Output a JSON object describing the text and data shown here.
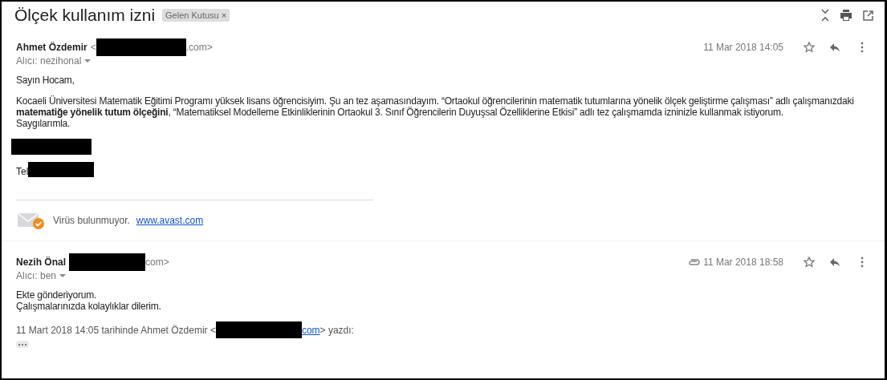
{
  "subject": "Ölçek kullanım izni",
  "label": {
    "text": "Gelen Kutusu",
    "close": "×"
  },
  "messages": [
    {
      "sender": "Ahmet Özdemir",
      "address_prefix": "<",
      "address_suffix": ".com>",
      "recipient": "Alıcı: nezihonal",
      "has_attachment": false,
      "date": "11 Mar 2018 14:05",
      "starred": false,
      "blocks": [
        {
          "kind": "text",
          "lines": [
            "Sayın Hocam,"
          ]
        },
        {
          "kind": "text",
          "lines": [
            "Kocaeli Üniversitesi Matematik Eğitimi Programı yüksek lisans öğrencisiyim. Şu an tez aşamasındayım. “Ortaokul öğrencilerinin matematik tutumlarına yönelik ölçek geliştirme çalışması” adlı çalışmanızdaki **matematiğe yönelik tutum ölçeğini**, “Matematiksel Modelleme Etkinliklerinin Ortaokul 3. Sınıf Öğrencilerin Duyuşsal Özelliklerine Etkisi” adlı tez çalışmamda izninizle kullanmak istiyorum.",
            "Saygılarımla."
          ]
        },
        {
          "kind": "redaction"
        },
        {
          "kind": "tel",
          "label": "Tel"
        },
        {
          "kind": "avast",
          "text": "Virüs bulunmuyor.",
          "link": "www.avast.com"
        }
      ]
    },
    {
      "sender": "Nezih Önal",
      "address_suffix": "com>",
      "recipient": "Alıcı: ben",
      "has_attachment": true,
      "date": "11 Mar 2018 18:58",
      "starred": false,
      "blocks": [
        {
          "kind": "text",
          "lines": [
            "Ekte gönderiyorum.",
            "Çalışmalarınızda kolaylıklar dilerim."
          ]
        },
        {
          "kind": "quote_header",
          "prefix": "11 Mart 2018 14:05 tarihinde Ahmet Özdemir <",
          "link": "com",
          "suffix": "> yazdı:"
        },
        {
          "kind": "expand"
        }
      ]
    }
  ]
}
